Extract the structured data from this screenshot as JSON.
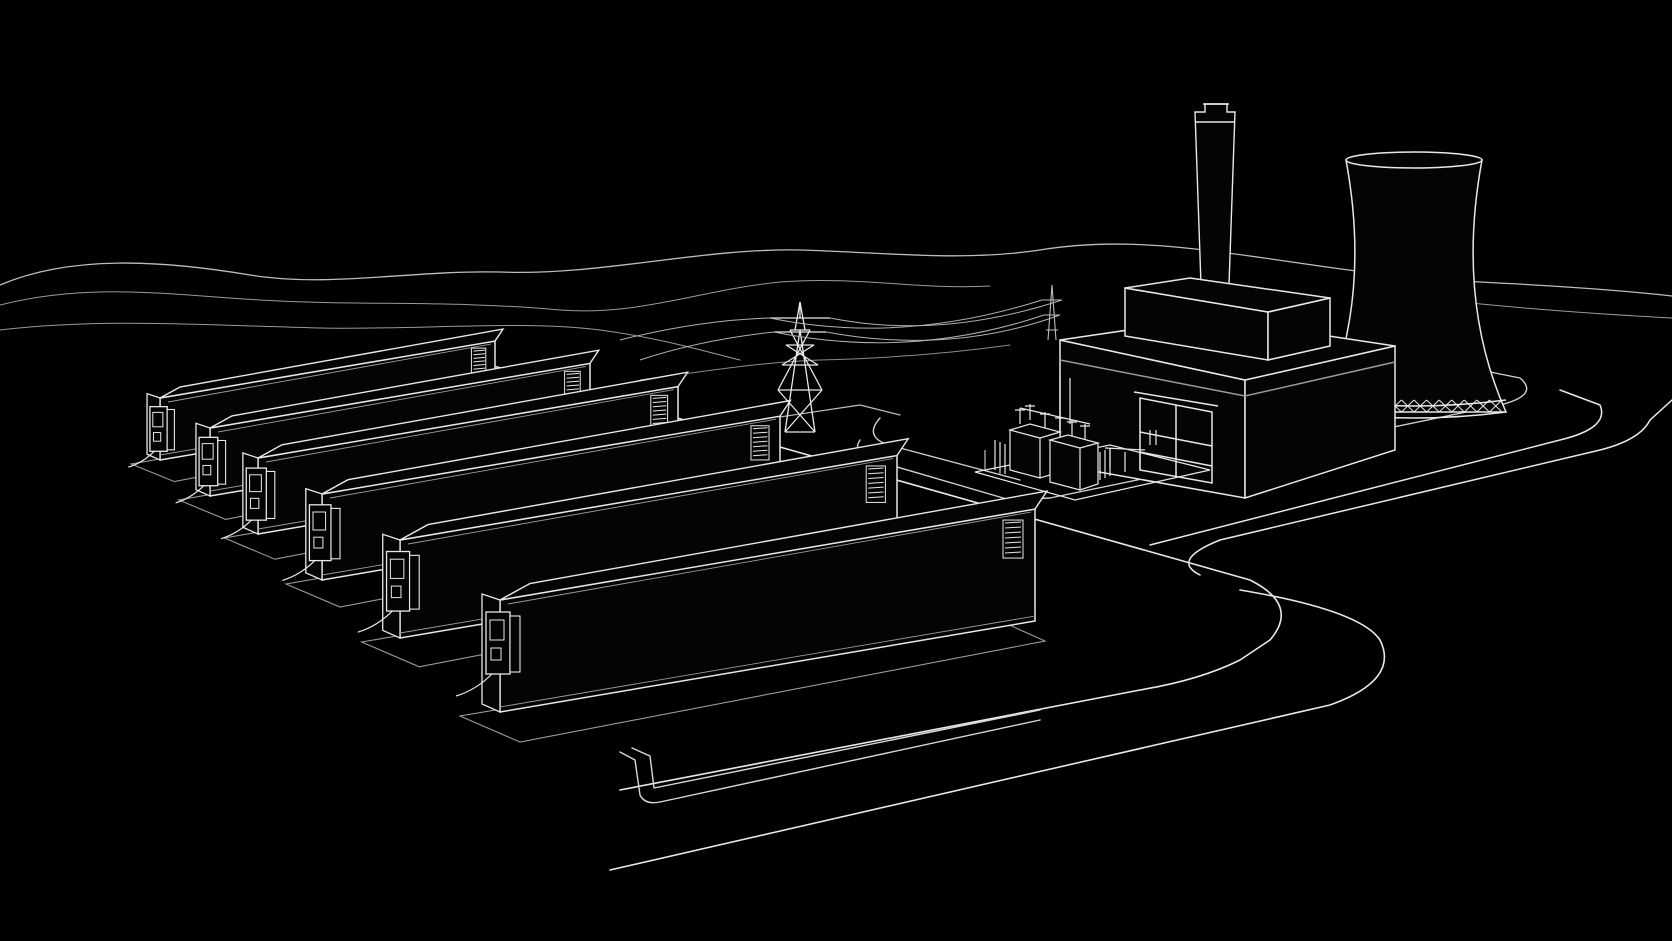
{
  "scene": {
    "background": "#000000",
    "line_color": "#e8e8e8",
    "dim_line_color": "#9a9a9a",
    "fill_color": "#040404",
    "container_count": 6,
    "icons": [
      "battery-container-icon",
      "transmission-tower-icon",
      "power-plant-icon",
      "chimney-icon",
      "cooling-tower-icon",
      "transformer-substation-icon",
      "road-icon"
    ]
  }
}
